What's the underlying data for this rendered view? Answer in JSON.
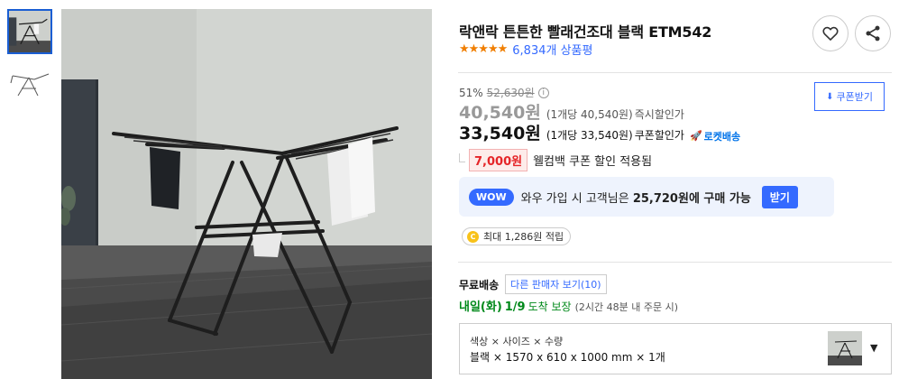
{
  "product": {
    "title": "락앤락 튼튼한 빨래건조대 블랙 ETM542",
    "stars": "★★★★★",
    "review_count": "6,834개 상품평",
    "discount_rate": "51%",
    "original_price": "52,630원",
    "info_icon": "i",
    "instant_price": "40,540원",
    "instant_unit_price": "(1개당 40,540원)",
    "instant_label": "즉시할인가",
    "coupon_price": "33,540원",
    "coupon_unit_price": "(1개당 33,540원)",
    "coupon_label": "쿠폰할인가",
    "rocket_label": "로켓배송",
    "coupon_button": "쿠폰받기",
    "welcome_amount": "7,000원",
    "welcome_text": "웰컴백 쿠폰 할인 적용됨",
    "wow_badge": "WOW",
    "wow_text_prefix": "와우 가입 시 고객님은",
    "wow_price": "25,720원에 구매 가능",
    "wow_button": "받기",
    "coin_symbol": "C",
    "points_text": "최대 1,286원 적립",
    "free_shipping": "무료배송",
    "other_sellers": "다른 판매자 보기(10)",
    "delivery_day": "내일(화)",
    "delivery_date": "1/9",
    "delivery_guarantee": "도착 보장",
    "delivery_note": "(2시간 48분 내 주문 시)",
    "option_label": "색상 × 사이즈 × 수량",
    "option_value": "블랙 × 1570 x 610 x 1000 mm × 1개",
    "option_caret": "▼"
  },
  "icons": {
    "heart": "heart-icon",
    "share": "share-icon",
    "download": "download-icon",
    "rocket": "rocket-icon",
    "coin": "coin-icon",
    "caret": "caret-down-icon"
  },
  "colors": {
    "accent_blue": "#346aff",
    "star_orange": "#f07e00",
    "welcome_red": "#e52528",
    "delivery_green": "#00891a",
    "wow_bg": "#eef3fd"
  }
}
